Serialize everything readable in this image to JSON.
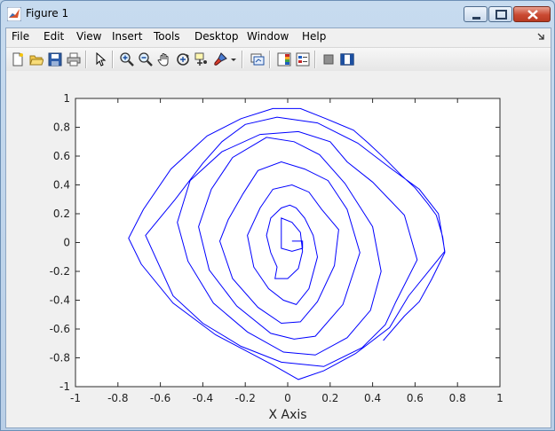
{
  "window": {
    "title": "Figure 1",
    "accent": "#b93a22"
  },
  "menu": {
    "items": [
      "File",
      "Edit",
      "View",
      "Insert",
      "Tools",
      "Desktop",
      "Window",
      "Help"
    ]
  },
  "toolbar": {
    "icons": [
      "new-figure-icon",
      "open-file-icon",
      "save-icon",
      "print-icon",
      "edit-plot-icon",
      "zoom-in-icon",
      "zoom-out-icon",
      "pan-icon",
      "rotate-3d-icon",
      "data-cursor-icon",
      "brush-icon",
      "link-plot-icon",
      "colorbar-icon",
      "legend-icon",
      "hide-plot-tools-icon",
      "show-plot-tools-icon"
    ]
  },
  "chart_data": {
    "type": "line",
    "title": "",
    "xlabel": "X Axis",
    "ylabel": "",
    "xlim": [
      -1,
      1
    ],
    "ylim": [
      -1,
      1
    ],
    "xticks": [
      "-1",
      "-0.8",
      "-0.6",
      "-0.4",
      "-0.2",
      "0",
      "0.2",
      "0.4",
      "0.6",
      "0.8",
      "1"
    ],
    "yticks": [
      "-1",
      "-0.8",
      "-0.6",
      "-0.4",
      "-0.2",
      "0",
      "0.2",
      "0.4",
      "0.6",
      "0.8",
      "1"
    ],
    "grid": false,
    "line_color": "#0000ff",
    "series": [
      {
        "x": [
          0.45,
          0.55,
          0.62,
          0.68,
          0.74,
          0.73,
          0.7,
          0.66,
          0.6,
          0.54,
          0.46,
          0.38,
          0.31,
          0.18,
          0.06,
          -0.07,
          -0.22,
          -0.38,
          -0.55,
          -0.68,
          -0.75,
          -0.69,
          -0.54,
          -0.34,
          -0.07,
          0.05,
          0.17,
          0.32,
          0.48,
          0.57,
          0.74,
          0.71,
          0.62,
          0.49,
          0.33,
          0.14,
          -0.05,
          -0.2,
          -0.31,
          -0.4,
          -0.53,
          -0.67,
          -0.54,
          -0.4,
          -0.22,
          -0.03,
          0.17,
          0.35,
          0.46,
          0.51,
          0.61,
          0.55,
          0.4,
          0.28,
          0.2,
          0.05,
          -0.13,
          -0.31,
          -0.46,
          -0.52,
          -0.47,
          -0.35,
          -0.19,
          -0.02,
          0.13,
          0.28,
          0.39,
          0.44,
          0.4,
          0.27,
          0.15,
          0.03,
          -0.1,
          -0.26,
          -0.36,
          -0.42,
          -0.37,
          -0.24,
          -0.08,
          0.03,
          0.13,
          0.26,
          0.34,
          0.28,
          0.19,
          0.08,
          -0.03,
          -0.14,
          -0.21,
          -0.28,
          -0.32,
          -0.26,
          -0.14,
          -0.03,
          0.06,
          0.14,
          0.22,
          0.24,
          0.16,
          0.1,
          0.02,
          -0.07,
          -0.13,
          -0.19,
          -0.16,
          -0.09,
          -0.02,
          0.04,
          0.1,
          0.14,
          0.12,
          0.08,
          0.04,
          0.01,
          -0.03,
          -0.08,
          -0.1,
          -0.08,
          -0.05,
          -0.06,
          0.0,
          0.05,
          0.07,
          0.06,
          0.02,
          -0.03,
          -0.03,
          0.02,
          0.07,
          0.07,
          0.02
        ],
        "y": [
          -0.68,
          -0.51,
          -0.41,
          -0.25,
          -0.07,
          0.04,
          0.19,
          0.27,
          0.38,
          0.46,
          0.58,
          0.69,
          0.78,
          0.86,
          0.93,
          0.93,
          0.86,
          0.74,
          0.51,
          0.23,
          0.03,
          -0.15,
          -0.42,
          -0.64,
          -0.85,
          -0.95,
          -0.89,
          -0.77,
          -0.59,
          -0.37,
          -0.06,
          0.2,
          0.37,
          0.51,
          0.69,
          0.83,
          0.87,
          0.82,
          0.7,
          0.55,
          0.3,
          0.05,
          -0.37,
          -0.56,
          -0.72,
          -0.83,
          -0.86,
          -0.73,
          -0.57,
          -0.41,
          -0.12,
          0.19,
          0.42,
          0.56,
          0.7,
          0.77,
          0.75,
          0.63,
          0.43,
          0.14,
          -0.13,
          -0.42,
          -0.62,
          -0.76,
          -0.78,
          -0.66,
          -0.47,
          -0.2,
          0.11,
          0.41,
          0.61,
          0.7,
          0.73,
          0.59,
          0.37,
          0.11,
          -0.19,
          -0.44,
          -0.63,
          -0.67,
          -0.65,
          -0.43,
          -0.07,
          0.23,
          0.43,
          0.51,
          0.56,
          0.5,
          0.34,
          0.16,
          0.01,
          -0.25,
          -0.45,
          -0.56,
          -0.55,
          -0.41,
          -0.16,
          0.09,
          0.23,
          0.35,
          0.4,
          0.37,
          0.24,
          0.05,
          -0.17,
          -0.32,
          -0.4,
          -0.43,
          -0.32,
          -0.1,
          0.05,
          0.17,
          0.24,
          0.26,
          0.24,
          0.17,
          0.05,
          -0.07,
          -0.17,
          -0.25,
          -0.25,
          -0.18,
          -0.06,
          0.07,
          0.14,
          0.17,
          -0.04,
          -0.06,
          -0.04,
          0.01,
          0.01
        ]
      }
    ]
  }
}
